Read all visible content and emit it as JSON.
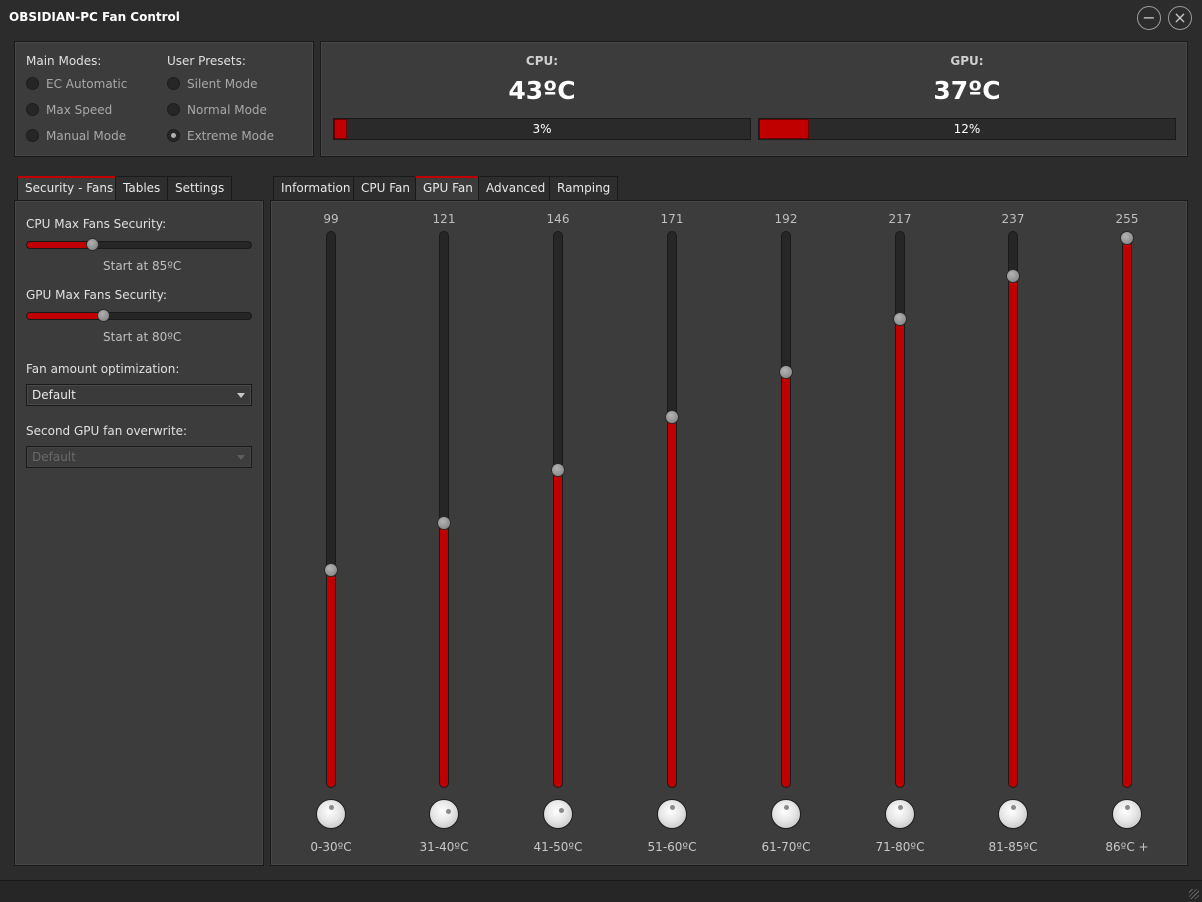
{
  "window": {
    "title": "OBSIDIAN-PC Fan Control",
    "minimize_glyph": "−",
    "close_glyph": "×"
  },
  "modes": {
    "main_title": "Main Modes:",
    "main": [
      {
        "label": "EC Automatic",
        "checked": false
      },
      {
        "label": "Max Speed",
        "checked": false
      },
      {
        "label": "Manual Mode",
        "checked": false
      }
    ],
    "presets_title": "User Presets:",
    "presets": [
      {
        "label": "Silent Mode",
        "checked": false
      },
      {
        "label": "Normal Mode",
        "checked": false
      },
      {
        "label": "Extreme Mode",
        "checked": true
      }
    ]
  },
  "temps": {
    "cpu": {
      "label": "CPU:",
      "value": "43ºC",
      "percent_text": "3%",
      "percent": 3
    },
    "gpu": {
      "label": "GPU:",
      "value": "37ºC",
      "percent_text": "12%",
      "percent": 12
    }
  },
  "left_tabs": [
    {
      "label": "Security - Fans",
      "active": true
    },
    {
      "label": "Tables",
      "active": false
    },
    {
      "label": "Settings",
      "active": false
    }
  ],
  "security": {
    "cpu_title": "CPU Max Fans Security:",
    "cpu_value_fraction": 0.29,
    "cpu_caption": "Start at 85ºC",
    "gpu_title": "GPU Max Fans Security:",
    "gpu_value_fraction": 0.34,
    "gpu_caption": "Start at 80ºC",
    "opt_title": "Fan amount optimization:",
    "opt_value": "Default",
    "second_title": "Second GPU fan overwrite:",
    "second_value": "Default"
  },
  "right_tabs": [
    {
      "label": "Information",
      "active": false
    },
    {
      "label": "CPU Fan",
      "active": false
    },
    {
      "label": "GPU Fan",
      "active": true
    },
    {
      "label": "Advanced",
      "active": false
    },
    {
      "label": "Ramping",
      "active": false
    }
  ],
  "gpu_fan": {
    "max_value": 255,
    "columns": [
      {
        "value": 99,
        "range": "0-30ºC"
      },
      {
        "value": 121,
        "range": "31-40ºC"
      },
      {
        "value": 146,
        "range": "41-50ºC"
      },
      {
        "value": 171,
        "range": "51-60ºC"
      },
      {
        "value": 192,
        "range": "61-70ºC"
      },
      {
        "value": 217,
        "range": "71-80ºC"
      },
      {
        "value": 237,
        "range": "81-85ºC"
      },
      {
        "value": 255,
        "range": "86ºC +"
      }
    ]
  },
  "colors": {
    "accent": "#c00000",
    "background": "#2c2c2c",
    "panel": "#3c3c3c"
  }
}
